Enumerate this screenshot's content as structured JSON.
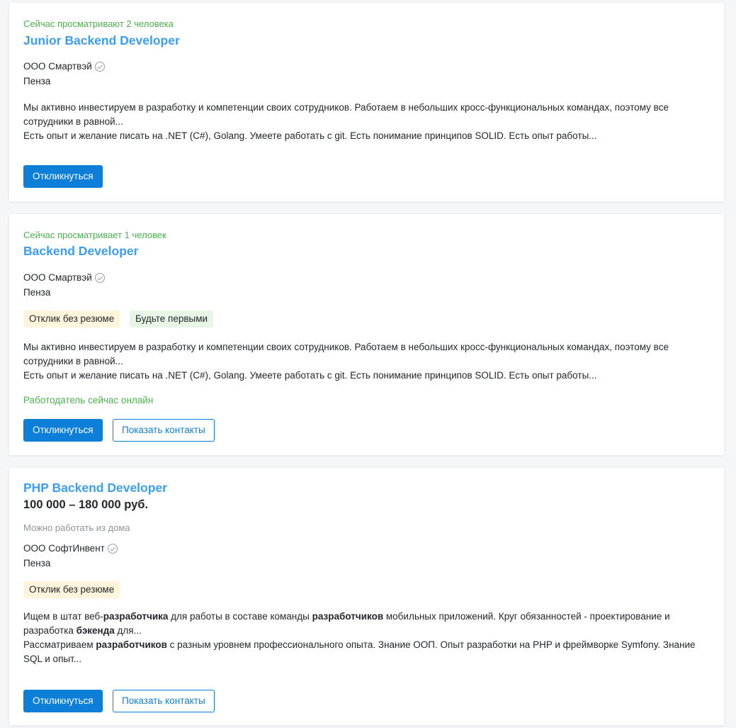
{
  "vacancies": [
    {
      "viewers": "Сейчас просматривают 2 человека",
      "title": "Junior Backend Developer",
      "company": "ООО Смартвэй",
      "city": "Пенза",
      "desc_1": "Мы активно инвестируем в разработку и компетенции своих сотрудников. Работаем в небольших кросс-функциональных командах, поэтому все сотрудники в равной...",
      "desc_2": "Есть опыт и желание писать на .NET (C#), Golang. Умеете работать с git. Есть понимание принципов SOLID. Есть опыт работы...",
      "respond_label": "Откликнуться"
    },
    {
      "viewers": "Сейчас просматривает 1 человек",
      "title": "Backend Developer",
      "company": "ООО Смартвэй",
      "city": "Пенза",
      "tags": [
        "Отклик без резюме",
        "Будьте первыми"
      ],
      "desc_1": "Мы активно инвестируем в разработку и компетенции своих сотрудников. Работаем в небольших кросс-функциональных командах, поэтому все сотрудники в равной...",
      "desc_2": "Есть опыт и желание писать на .NET (C#), Golang. Умеете работать с git. Есть понимание принципов SOLID. Есть опыт работы...",
      "online": "Работодатель сейчас онлайн",
      "respond_label": "Откликнуться",
      "contacts_label": "Показать контакты"
    },
    {
      "title": "PHP Backend Developer",
      "salary": "100 000 – 180 000 руб.",
      "remote": "Можно работать из дома",
      "company": "ООО СофтИнвент",
      "city": "Пенза",
      "tags": [
        "Отклик без резюме"
      ],
      "desc_1_parts": [
        "Ищем в штат веб-",
        "разработчика",
        " для работы в составе команды ",
        "разработчиков",
        " мобильных приложений. Круг обязанностей - проектирование и разработка ",
        "бэкенда",
        " для..."
      ],
      "desc_2_parts": [
        "Рассматриваем ",
        "разработчиков",
        " с разным уровнем профессионального опыта. Знание ООП. Опыт разработки на PHP и фреймворке Symfony. Знание SQL и опыт..."
      ],
      "respond_label": "Откликнуться",
      "contacts_label": "Показать контакты"
    }
  ],
  "colors": {
    "accent": "#0d7fd8",
    "link": "#3c9df2",
    "online": "#4bb24e",
    "tag_yellow": "#fff4dc",
    "tag_green": "#e8f6e8"
  }
}
